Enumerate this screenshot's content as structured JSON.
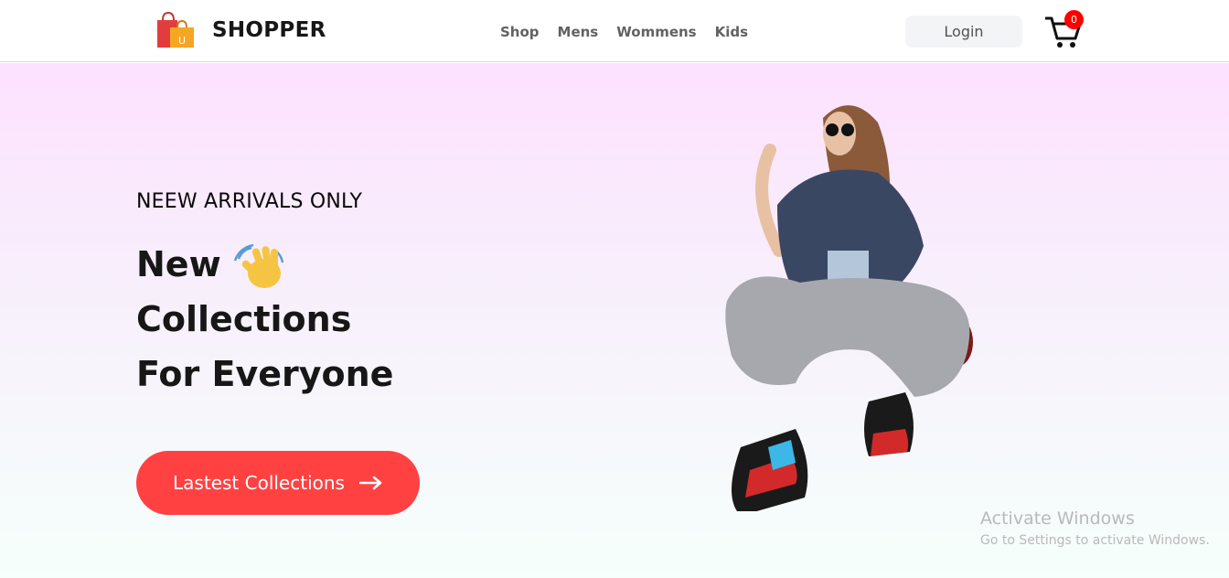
{
  "brand": {
    "name": "SHOPPER",
    "logo_icon": "shopping-bags-icon"
  },
  "nav": {
    "items": [
      "Shop",
      "Mens",
      "Wommens",
      "Kids"
    ]
  },
  "header": {
    "login_label": "Login",
    "cart_icon": "shopping-cart-icon",
    "cart_count": "0"
  },
  "hero": {
    "kicker": "NEEW ARRIVALS ONLY",
    "line1": "New",
    "line2": "Collections",
    "line3": "For Everyone",
    "hand_icon": "waving-hand-icon",
    "cta_label": "Lastest Collections",
    "cta_icon": "arrow-right-icon",
    "model_image": "fashion-model-photo"
  },
  "watermark": {
    "title": "Activate Windows",
    "subtitle": "Go to Settings to activate Windows."
  },
  "colors": {
    "accent": "#ff4141",
    "badge": "#ff0000",
    "hero_gradient_top": "#fde1ff",
    "hero_gradient_bottom": "#f6fffb"
  }
}
